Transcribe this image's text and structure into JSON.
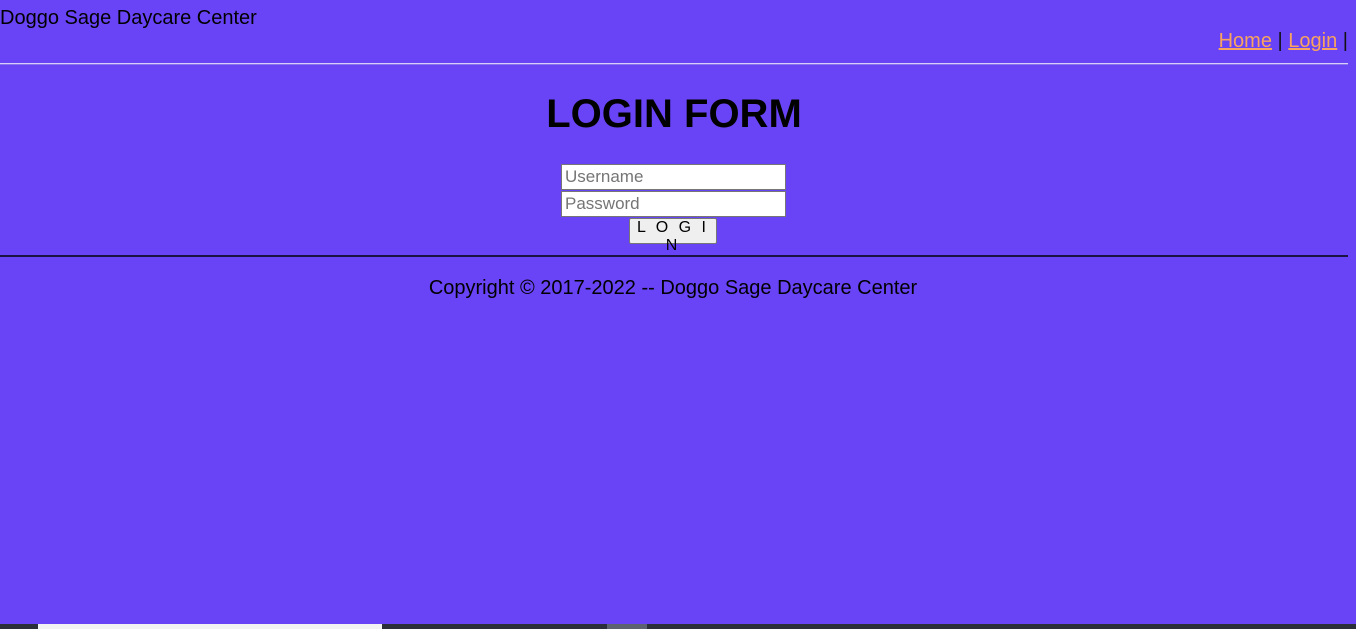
{
  "header": {
    "site_title": "Doggo Sage Daycare Center",
    "nav": {
      "home_label": "Home",
      "separator": "|",
      "login_label": "Login",
      "trailing_separator": "|"
    }
  },
  "login_form": {
    "title": "LOGIN FORM",
    "username_placeholder": "Username",
    "username_value": "",
    "password_placeholder": "Password",
    "password_value": "",
    "submit_label": "L O G I N"
  },
  "footer": {
    "copyright": "Copyright © 2017-2022 -- Doggo Sage Daycare Center"
  },
  "colors": {
    "background": "#6943f6",
    "link": "#f8a35e",
    "text": "#000000"
  }
}
